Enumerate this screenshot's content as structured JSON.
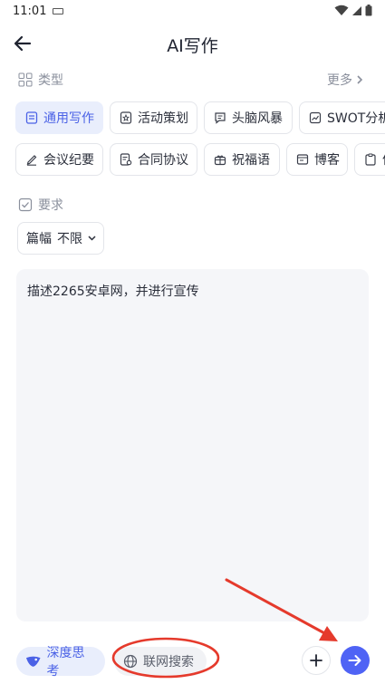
{
  "status_bar": {
    "time": "11:01"
  },
  "header": {
    "title": "AI写作"
  },
  "category_section": {
    "label": "类型",
    "more_label": "更多"
  },
  "categories_row1": [
    "通用写作",
    "活动策划",
    "头脑风暴",
    "SWOT分析"
  ],
  "categories_row2": [
    "会议纪要",
    "合同协议",
    "祝福语",
    "博客",
    "信"
  ],
  "requirement_section": {
    "label": "要求"
  },
  "length_select": {
    "label": "篇幅",
    "value": "不限"
  },
  "prompt_input": {
    "value": "描述2265安卓网，并进行宣传"
  },
  "bottom_bar": {
    "deep_think_label": "深度思考",
    "web_search_label": "联网搜索"
  },
  "colors": {
    "accent": "#4f63f5",
    "annotation_red": "#e53a2c"
  }
}
